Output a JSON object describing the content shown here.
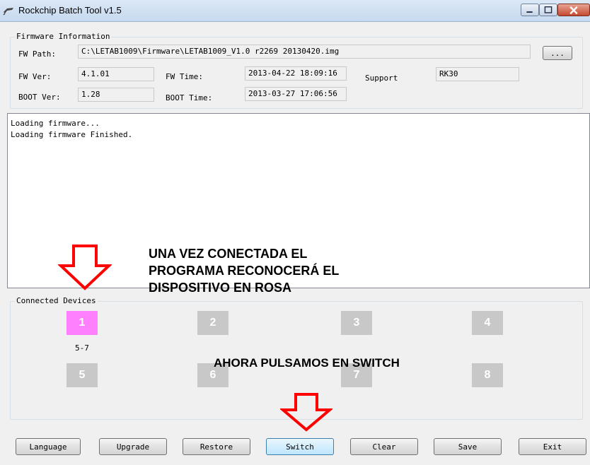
{
  "window": {
    "title": "Rockchip Batch Tool v1.5"
  },
  "firmware": {
    "group_label": "Firmware Information",
    "path_label": "FW Path:",
    "path_value": "C:\\LETAB1009\\Firmware\\LETAB1009_V1.0 r2269 20130420.img",
    "browse_label": "...",
    "fw_ver_label": "FW Ver:",
    "fw_ver_value": "4.1.01",
    "fw_time_label": "FW Time:",
    "fw_time_value": "2013-04-22 18:09:16",
    "support_label": "Support",
    "support_value": "RK30",
    "boot_ver_label": "BOOT Ver:",
    "boot_ver_value": "1.28",
    "boot_time_label": "BOOT Time:",
    "boot_time_value": "2013-03-27 17:06:56"
  },
  "log": {
    "lines": [
      "Loading firmware...",
      "Loading firmware Finished."
    ]
  },
  "devices": {
    "group_label": "Connected Devices",
    "slots": [
      {
        "num": "1",
        "active": true,
        "label": "5-7"
      },
      {
        "num": "2",
        "active": false,
        "label": ""
      },
      {
        "num": "3",
        "active": false,
        "label": ""
      },
      {
        "num": "4",
        "active": false,
        "label": ""
      },
      {
        "num": "5",
        "active": false,
        "label": ""
      },
      {
        "num": "6",
        "active": false,
        "label": ""
      },
      {
        "num": "7",
        "active": false,
        "label": ""
      },
      {
        "num": "8",
        "active": false,
        "label": ""
      }
    ],
    "active_color": "#ff80ff",
    "inactive_color": "#c8c8c8"
  },
  "annotations": {
    "note1": "UNA VEZ CONECTADA EL\nPROGRAMA RECONOCERÁ EL\nDISPOSITIVO EN ROSA",
    "note2": "AHORA PULSAMOS EN SWITCH",
    "arrow_color": "#ff0000"
  },
  "buttons": {
    "language": "Language",
    "upgrade": "Upgrade",
    "restore": "Restore",
    "switch": "Switch",
    "clear": "Clear",
    "save": "Save",
    "exit": "Exit"
  }
}
